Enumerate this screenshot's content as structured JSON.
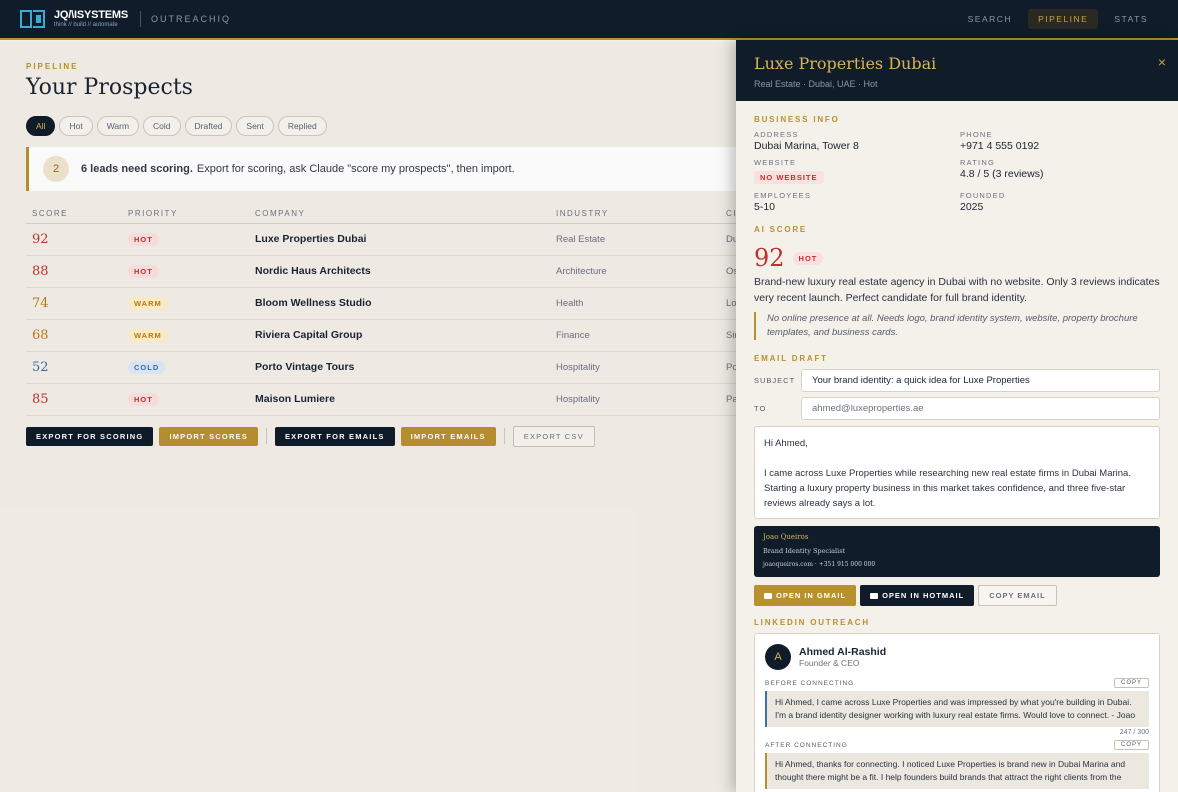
{
  "brand": {
    "name": "JQ/\\ISYSTEMS",
    "tagline": "think // build // automate",
    "app": "OUTREACHIQ"
  },
  "nav": {
    "items": [
      {
        "label": "SEARCH",
        "active": false
      },
      {
        "label": "PIPELINE",
        "active": true
      },
      {
        "label": "STATS",
        "active": false
      }
    ]
  },
  "main": {
    "eyebrow": "PIPELINE",
    "title": "Your Prospects",
    "filters": [
      "All",
      "Hot",
      "Warm",
      "Cold",
      "Drafted",
      "Sent",
      "Replied"
    ],
    "notice": {
      "count": "2",
      "bold": "6 leads need scoring.",
      "text": "Export for scoring, ask Claude \"score my prospects\", then import."
    },
    "table": {
      "headers": [
        "SCORE",
        "PRIORITY",
        "COMPANY",
        "INDUSTRY",
        "CI"
      ],
      "rows": [
        {
          "score": "92",
          "priority": "HOT",
          "company": "Luxe Properties Dubai",
          "industry": "Real Estate",
          "city": "Du"
        },
        {
          "score": "88",
          "priority": "HOT",
          "company": "Nordic Haus Architects",
          "industry": "Architecture",
          "city": "Os"
        },
        {
          "score": "74",
          "priority": "WARM",
          "company": "Bloom Wellness Studio",
          "industry": "Health",
          "city": "Lo"
        },
        {
          "score": "68",
          "priority": "WARM",
          "company": "Riviera Capital Group",
          "industry": "Finance",
          "city": "Sir"
        },
        {
          "score": "52",
          "priority": "COLD",
          "company": "Porto Vintage Tours",
          "industry": "Hospitality",
          "city": "Po"
        },
        {
          "score": "85",
          "priority": "HOT",
          "company": "Maison Lumiere",
          "industry": "Hospitality",
          "city": "Pa"
        }
      ]
    },
    "actions": {
      "export_scoring": "EXPORT FOR SCORING",
      "import_scores": "IMPORT SCORES",
      "export_emails": "EXPORT FOR EMAILS",
      "import_emails": "IMPORT EMAILS",
      "export_csv": "EXPORT CSV"
    }
  },
  "colors": {
    "hot_text": "#c0302e",
    "hot_bg": "#fbe0e0",
    "warm_text": "#c07a14",
    "warm_bg": "#fdefc8",
    "cold_text": "#3a6fa8",
    "cold_bg": "#dde9f7",
    "gold": "#b8912f",
    "navy": "#111c2b"
  },
  "drawer": {
    "title": "Luxe Properties Dubai",
    "subtitle": "Real Estate · Dubai, UAE · Hot",
    "close": "×",
    "business_info": {
      "heading": "BUSINESS INFO",
      "address_label": "ADDRESS",
      "address": "Dubai Marina, Tower 8",
      "phone_label": "PHONE",
      "phone": "+971 4 555 0192",
      "website_label": "WEBSITE",
      "website": "NO WEBSITE",
      "rating_label": "RATING",
      "rating": "4.8 / 5 (3 reviews)",
      "employees_label": "EMPLOYEES",
      "employees": "5-10",
      "founded_label": "FOUNDED",
      "founded": "2025"
    },
    "ai_score": {
      "heading": "AI SCORE",
      "value": "92",
      "badge": "HOT",
      "summary": "Brand-new luxury real estate agency in Dubai with no website. Only 3 reviews indicates very recent launch. Perfect candidate for full brand identity.",
      "note": "No online presence at all. Needs logo, brand identity system, website, property brochure templates, and business cards."
    },
    "email": {
      "heading": "EMAIL DRAFT",
      "subject_label": "SUBJECT",
      "subject": "Your brand identity: a quick idea for Luxe Properties",
      "to_label": "TO",
      "to": "ahmed@luxeproperties.ae",
      "greeting": "Hi Ahmed,",
      "body": "I came across Luxe Properties while researching new real estate firms in Dubai Marina. Starting a luxury property business in this market takes confidence, and three five-star reviews already says a lot.",
      "signature": {
        "name": "Joao Queiros",
        "role": "Brand Identity Specialist",
        "contact": "joaoqueiros.com · +351 915 000 000"
      },
      "open_gmail": "OPEN IN GMAIL",
      "open_hotmail": "OPEN IN HOTMAIL",
      "copy_email": "COPY EMAIL"
    },
    "linkedin": {
      "heading": "LINKEDIN OUTREACH",
      "initial": "A",
      "name": "Ahmed Al-Rashid",
      "role": "Founder & CEO",
      "before_label": "BEFORE CONNECTING",
      "before_msg": "Hi Ahmed, I came across Luxe Properties and was impressed by what you're building in Dubai. I'm a brand identity designer working with luxury real estate firms. Would love to connect. - Joao",
      "before_count": "247 / 300",
      "after_label": "AFTER CONNECTING",
      "after_msg": "Hi Ahmed, thanks for connecting. I noticed Luxe Properties is brand new in Dubai Marina and thought there might be a fit. I help founders build brands that attract the right clients from the",
      "copy": "COPY"
    }
  }
}
